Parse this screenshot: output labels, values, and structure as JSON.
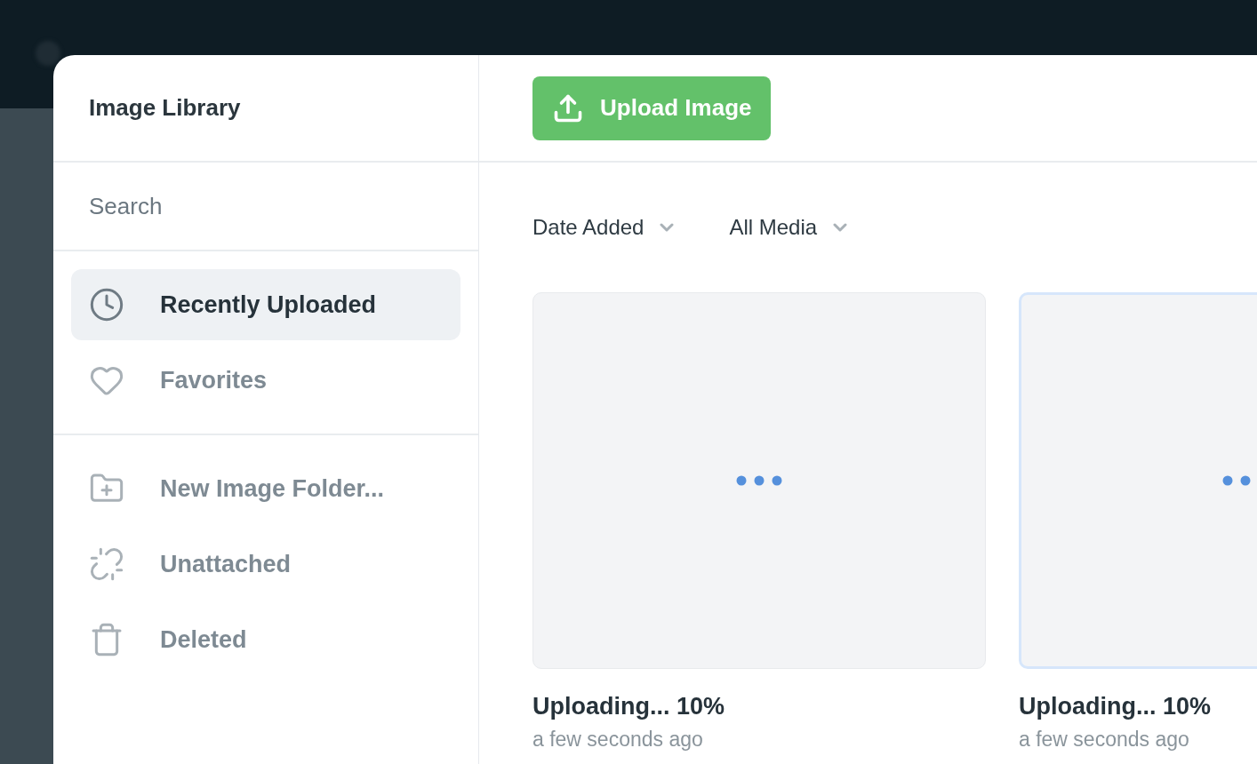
{
  "modal": {
    "title": "Image Library",
    "upload_button": "Upload Image",
    "search": {
      "placeholder": "Search"
    },
    "nav_sections": [
      {
        "items": [
          {
            "label": "Recently Uploaded",
            "selected": true
          },
          {
            "label": "Favorites",
            "selected": false
          }
        ]
      },
      {
        "items": [
          {
            "label": "New Image Folder...",
            "selected": false
          },
          {
            "label": "Unattached",
            "selected": false
          },
          {
            "label": "Deleted",
            "selected": false
          }
        ]
      }
    ],
    "filters": [
      {
        "label": "Date Added"
      },
      {
        "label": "All Media"
      }
    ],
    "images": [
      {
        "title": "Uploading... 10%",
        "time": "a few seconds ago",
        "selected": false
      },
      {
        "title": "Uploading... 10%",
        "time": "a few seconds ago",
        "selected": true
      }
    ]
  }
}
